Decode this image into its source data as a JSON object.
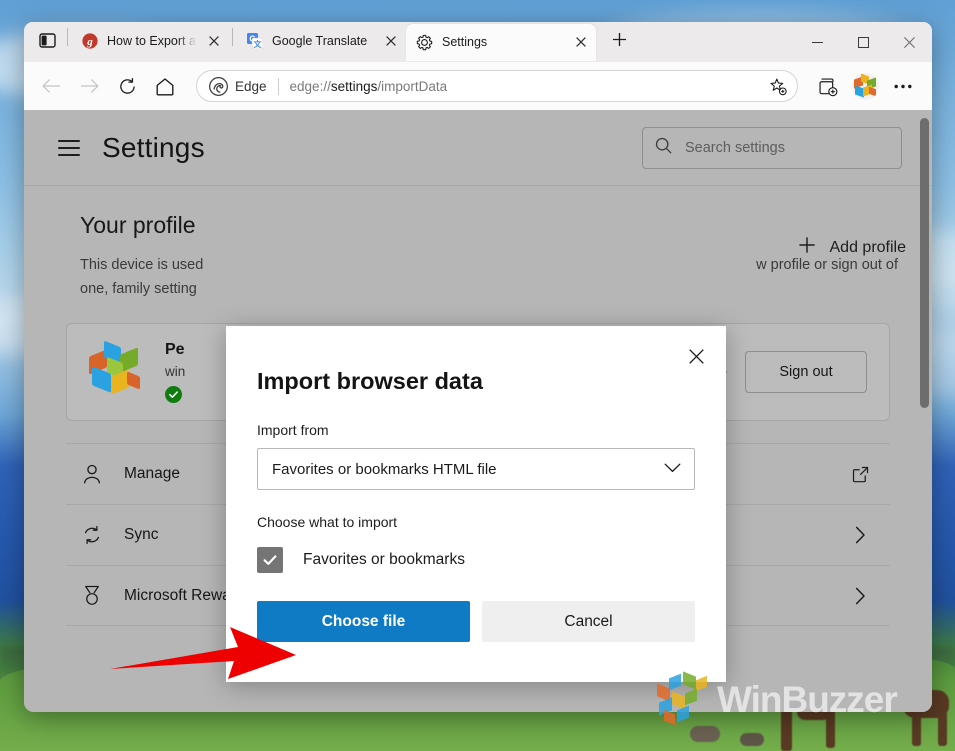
{
  "window": {
    "controls": {
      "minimize": "minimize-button",
      "maximize": "maximize-button",
      "close": "close-button"
    }
  },
  "tabstrip": {
    "tab_search_label": "tab-actions-menu",
    "new_tab_label": "New tab",
    "tabs": [
      {
        "title": "How to Export a",
        "favicon": "g-red-icon",
        "active": false
      },
      {
        "title": "Google Translate",
        "favicon": "google-translate-icon",
        "active": false
      },
      {
        "title": "Settings",
        "favicon": "gear-icon",
        "active": true
      }
    ]
  },
  "toolbar": {
    "back": "Back",
    "forward": "Forward",
    "refresh": "Refresh",
    "home": "Home",
    "omnibox": {
      "brand": "Edge",
      "url_prefix": "edge://",
      "url_strong": "settings",
      "url_suffix": "/importData",
      "url_full": "edge://settings/importData"
    },
    "favorite": "Add this page to favorites",
    "collections": "Collections",
    "profile": "Profile",
    "more": "Settings and more"
  },
  "settings": {
    "title": "Settings",
    "search": {
      "placeholder": "Search settings",
      "value": ""
    },
    "profile_section": {
      "heading": "Your profile",
      "add_profile_label": "Add profile",
      "description_line1": "This device is used",
      "description_line1_right": "w profile or sign out of",
      "description_line2": "one, family setting",
      "card": {
        "name": "Pe",
        "email": "win",
        "sync_status": "",
        "more_label": "•",
        "sign_out_label": "Sign out"
      }
    },
    "rows": [
      {
        "label": "Manage",
        "icon": "person-icon",
        "trailing_icon": "external-link-icon"
      },
      {
        "label": "Sync",
        "icon": "sync-icon",
        "trailing_icon": "chevron-right-icon"
      },
      {
        "label": "Microsoft Rewards",
        "icon": "medal-icon",
        "trailing_icon": "chevron-right-icon"
      }
    ]
  },
  "modal": {
    "title": "Import browser data",
    "close_label": "Close",
    "import_from_label": "Import from",
    "import_from_value": "Favorites or bookmarks HTML file",
    "choose_what_label": "Choose what to import",
    "checkbox_label": "Favorites or bookmarks",
    "checkbox_checked": true,
    "primary_button": "Choose file",
    "secondary_button": "Cancel"
  },
  "annotation": {
    "arrow_color": "#ee0000",
    "arrow_target": "Choose file"
  },
  "watermark": {
    "text": "WinBuzzer"
  },
  "colors": {
    "accent_blue": "#0f7bc4",
    "page_gray": "#b6b6b6",
    "toolbar": "#fbfbfb",
    "tabstrip": "#eceaea",
    "green_check": "#107c10"
  }
}
